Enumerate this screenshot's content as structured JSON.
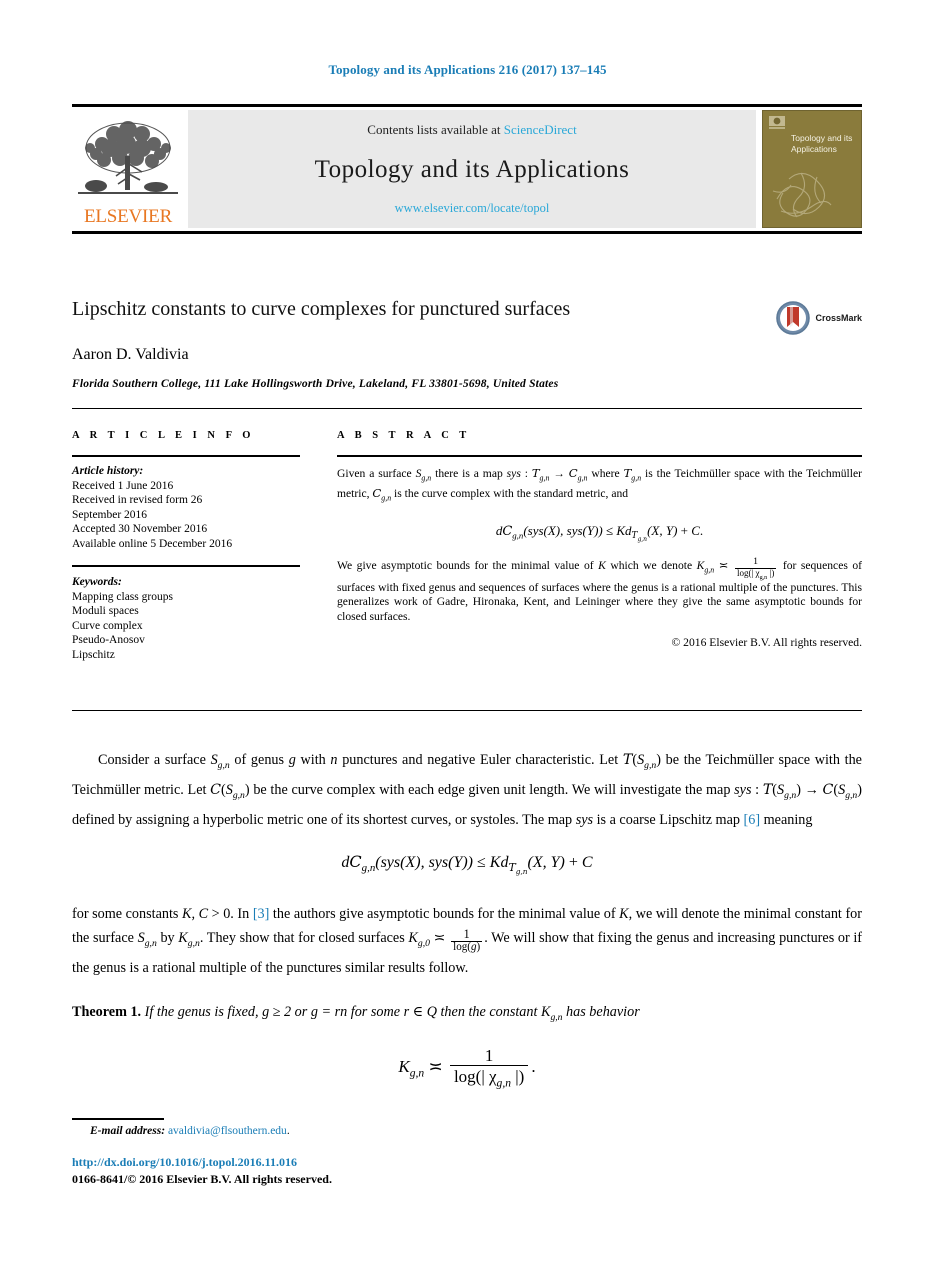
{
  "running_head": "Topology and its Applications 216 (2017) 137–145",
  "masthead": {
    "contents_prefix": "Contents lists available at",
    "sciencedirect": "ScienceDirect",
    "journal_title": "Topology and its Applications",
    "journal_url": "www.elsevier.com/locate/topol",
    "publisher_wordmark": "ELSEVIER",
    "cover_title": "Topology and its Applications"
  },
  "article": {
    "title": "Lipschitz constants to curve complexes for punctured surfaces",
    "author": "Aaron D. Valdivia",
    "affiliation": "Florida Southern College, 111 Lake Hollingsworth Drive, Lakeland, FL 33801-5698, United States",
    "crossmark_label": "CrossMark"
  },
  "info": {
    "section_label": "A R T I C L E   I N F O",
    "history_head": "Article history:",
    "history": [
      "Received 1 June 2016",
      "Received in revised form 26",
      "September 2016",
      "Accepted 30 November 2016",
      "Available online 5 December 2016"
    ],
    "keywords_head": "Keywords:",
    "keywords": [
      "Mapping class groups",
      "Moduli spaces",
      "Curve complex",
      "Pseudo-Anosov",
      "Lipschitz"
    ]
  },
  "abstract": {
    "section_label": "A B S T R A C T",
    "para1_a": "Given a surface ",
    "para1_sym_S": "S",
    "para1_sub_gn": "g,n",
    "para1_b": " there is a map ",
    "para1_sys": "sys",
    "para1_colon": " : ",
    "para1_T": "T",
    "para1_arrow": " → ",
    "para1_C": "C",
    "para1_c": " where ",
    "para1_d": " is the Teichmüller space with the Teichmüller metric, ",
    "para1_e": " is the curve complex with the standard metric, and",
    "equation": "dC_{g,n}(sys(X), sys(Y)) ≤ Kd_{T_{g,n}}(X, Y) + C.",
    "para2_a": "We give asymptotic bounds for the minimal value of ",
    "para2_K": "K",
    "para2_b": " which we denote ",
    "para2_Kgn": "K",
    "para2_asymp": " ≍ ",
    "frac_num": "1",
    "frac_den": "log(| χ",
    "frac_den_sub": "g,n",
    "frac_den_end": " |)",
    "para2_c": " for sequences of surfaces with fixed genus and sequences of surfaces where the genus is a rational multiple of the punctures. This generalizes work of Gadre, Hironaka, Kent, and Leininger where they give the same asymptotic bounds for closed surfaces.",
    "copyright": "© 2016 Elsevier B.V. All rights reserved."
  },
  "body": {
    "p1_a": "Consider a surface ",
    "p1_b": " of genus ",
    "p1_g": "g",
    "p1_c": " with ",
    "p1_n": "n",
    "p1_d": " punctures and negative Euler characteristic. Let ",
    "p1_e": " be the Teichmüller space with the Teichmüller metric. Let ",
    "p1_f": " be the curve complex with each edge given unit length. We will investigate the map ",
    "p1_sys": "sys",
    "p1_g2": " defined by assigning a hyperbolic metric one of its shortest curves, or systoles. The map ",
    "p1_h": " is a coarse Lipschitz map ",
    "p1_cite": "[6]",
    "p1_i": " meaning",
    "eq1": "dC_{g,n}(sys(X), sys(Y)) ≤ Kd_{T_{g,n}}(X,Y) + C",
    "p2_a": "for some constants ",
    "p2_KC": "K, C",
    "p2_b": " > 0. In ",
    "p2_cite": "[3]",
    "p2_c": " the authors give asymptotic bounds for the minimal value of ",
    "p2_K": "K",
    "p2_d": ", we will denote the minimal constant for the surface ",
    "p2_e": " by ",
    "p2_f": ". They show that for closed surfaces ",
    "p2_g": ". We will show that fixing the genus and increasing punctures or if the genus is a rational multiple of the punctures similar results follow.",
    "theorem_head": "Theorem 1.",
    "theorem_text_a": " If the genus is fixed, ",
    "theorem_text_b": " ≥ 2 or ",
    "theorem_text_c": " = rn for some r ∈ Q then the constant ",
    "theorem_text_d": " has behavior",
    "theorem_eq_lhs": "K",
    "theorem_eq_sub": "g,n",
    "theorem_eq_rel": " ≍ ",
    "theorem_eq_num": "1",
    "theorem_eq_den_a": "log(| χ",
    "theorem_eq_den_sub": "g,n",
    "theorem_eq_den_b": " |)"
  },
  "footer": {
    "email_label": "E-mail address:",
    "email_address": "avaldivia@flsouthern.edu",
    "email_period": ".",
    "doi": "http://dx.doi.org/10.1016/j.topol.2016.11.016",
    "issn": "0166-8641/© 2016 Elsevier B.V. All rights reserved."
  },
  "colors": {
    "link": "#1a7db6",
    "sciencedirect": "#2aa8d8",
    "elsevier_orange": "#E87722",
    "cover": "#8a7b3c"
  }
}
